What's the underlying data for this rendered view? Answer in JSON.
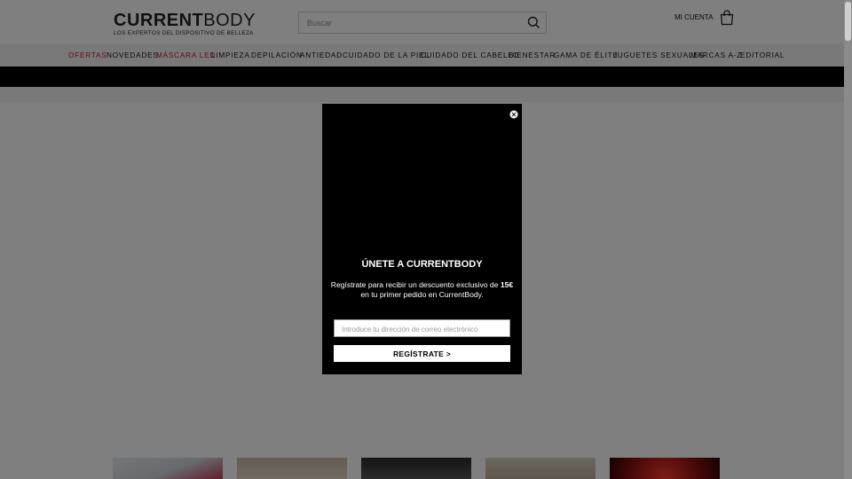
{
  "header": {
    "logo_bold": "CURRENT",
    "logo_light": "BODY",
    "logo_tagline": "LOS EXPERTOS DEL DISPOSITIVO DE BELLEZA",
    "search_placeholder": "Buscar",
    "account_label": "MI CUENTA"
  },
  "nav": {
    "items": [
      {
        "label": "OFERTAS",
        "highlight": true
      },
      {
        "label": "NOVEDADES",
        "highlight": false
      },
      {
        "label": "MÁSCARA LED",
        "highlight": true
      },
      {
        "label": "LIMPIEZA",
        "highlight": false
      },
      {
        "label": "DEPILACIÓN",
        "highlight": false
      },
      {
        "label": "ANTIEDAD",
        "highlight": false
      },
      {
        "label": "CUIDADO DE LA PIEL",
        "highlight": false
      },
      {
        "label": "CUIDADO DEL CABELLO",
        "highlight": false
      },
      {
        "label": "BIENESTAR",
        "highlight": false
      },
      {
        "label": "GAMA DE ÉLITE",
        "highlight": false
      },
      {
        "label": "JUGUETES SEXUALES",
        "highlight": false
      },
      {
        "label": "MARCAS A-Z",
        "highlight": false
      },
      {
        "label": "EDITORIAL",
        "highlight": false
      }
    ]
  },
  "modal": {
    "title": "ÚNETE A CURRENTBODY",
    "desc_part1": "Regístrate para recibir un descuento exclusivo de ",
    "desc_amount": "15€",
    "desc_part2": "en tu primer pedido en CurrentBody.",
    "email_placeholder": "Introduce tu dirección de correo electrónico",
    "submit_label": "REGÍSTRATE >"
  },
  "colors": {
    "accent_red": "#c8102e",
    "overlay": "rgba(0,0,0,0.5)",
    "modal_bg": "#000000"
  }
}
